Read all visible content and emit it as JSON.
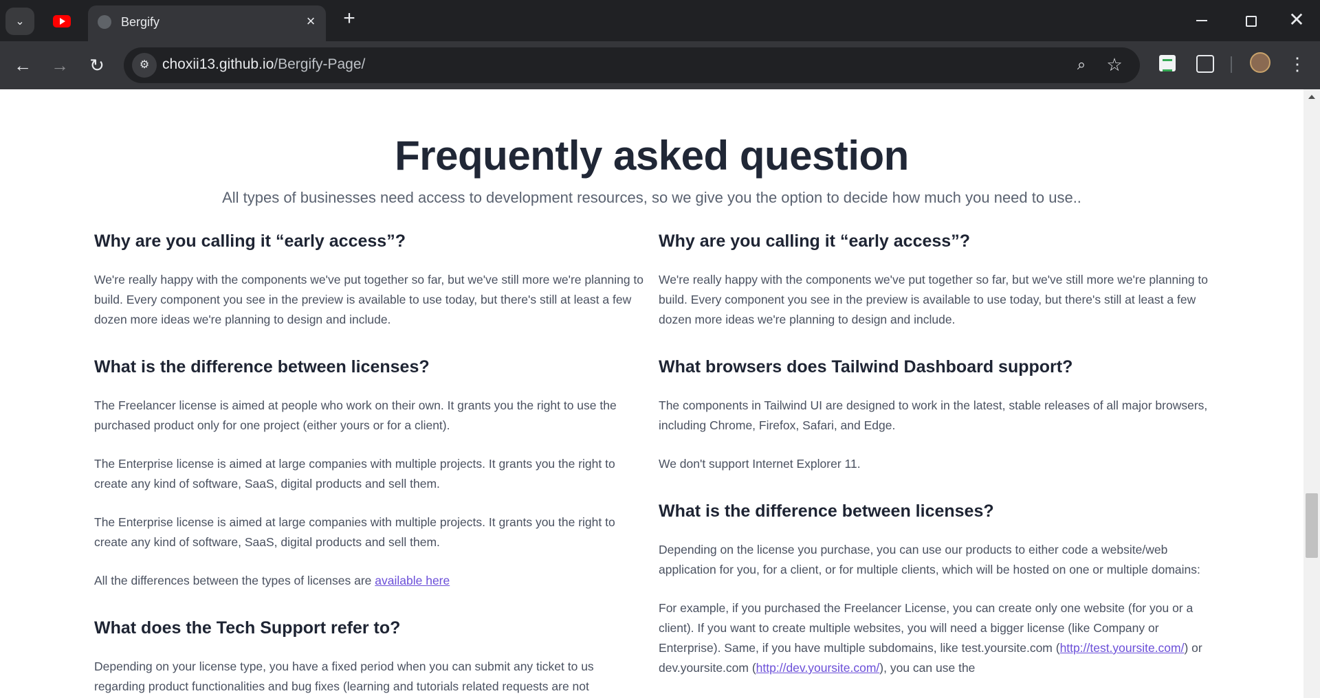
{
  "browser": {
    "tab_title": "Bergify",
    "url_host": "choxii13.github.io",
    "url_path": "/Bergify-Page/",
    "icons": {
      "tab_list": "chevron-down-icon",
      "youtube_tab": "youtube-icon",
      "favicon": "globe-icon",
      "tab_close": "close-icon",
      "new_tab": "plus-icon",
      "back": "arrow-left-icon",
      "forward": "arrow-right-icon",
      "reload": "reload-icon",
      "site_info": "tune-icon",
      "zoom": "zoom-icon",
      "bookmark": "star-icon",
      "extension_sheets": "sheets-icon",
      "extensions": "puzzle-icon",
      "profile": "avatar",
      "menu": "kebab-icon"
    },
    "colors": {
      "frame": "#202124",
      "toolbar": "#35363a"
    }
  },
  "faq": {
    "title": "Frequently asked question",
    "subtitle": "All types of businesses need access to development resources, so we give you the option to decide how much you need to use..",
    "left": [
      {
        "question": "Why are you calling it “early access”?",
        "answers": [
          "We're really happy with the components we've put together so far, but we've still more we're planning to build. Every component you see in the preview is available to use today, but there's still at least a few dozen more ideas we're planning to design and include."
        ]
      },
      {
        "question": "What is the difference between licenses?",
        "answers": [
          "The Freelancer license is aimed at people who work on their own. It grants you the right to use the purchased product only for one project (either yours or for a client).",
          "The Enterprise license is aimed at large companies with multiple projects. It grants you the right to create any kind of software, SaaS, digital products and sell them.",
          "The Enterprise license is aimed at large companies with multiple projects. It grants you the right to create any kind of software, SaaS, digital products and sell them."
        ],
        "link_prefix": "All the differences between the types of licenses are ",
        "link_text": "available here"
      },
      {
        "question": "What does the Tech Support refer to?",
        "answers": [
          "Depending on your license type, you have a fixed period when you can submit any ticket to us regarding product functionalities and bug fixes (learning and tutorials related requests are not"
        ]
      }
    ],
    "right": [
      {
        "question": "Why are you calling it “early access”?",
        "answers": [
          "We're really happy with the components we've put together so far, but we've still more we're planning to build. Every component you see in the preview is available to use today, but there's still at least a few dozen more ideas we're planning to design and include."
        ]
      },
      {
        "question": "What browsers does Tailwind Dashboard support?",
        "answers": [
          "The components in Tailwind UI are designed to work in the latest, stable releases of all major browsers, including Chrome, Firefox, Safari, and Edge.",
          "We don't support Internet Explorer 11."
        ]
      },
      {
        "question": "What is the difference between licenses?",
        "answers": [
          "Depending on the license you purchase, you can use our products to either code a website/web application for you, for a client, or for multiple clients, which will be hosted on one or multiple domains:"
        ],
        "example_text": "For example, if you purchased the Freelancer License, you can create only one website (for you or a client). If you want to create multiple websites, you will need a bigger license (like Company or Enterprise). Same, if you have multiple subdomains, like test.yoursite.com (",
        "example_link1": "http://test.yoursite.com/",
        "example_mid": ") or dev.yoursite.com (",
        "example_link2": "http://dev.yoursite.com/",
        "example_tail": "), you can use the"
      }
    ],
    "colors": {
      "heading": "#1e2433",
      "body": "#4a5160",
      "link": "#6b4fd8"
    }
  }
}
